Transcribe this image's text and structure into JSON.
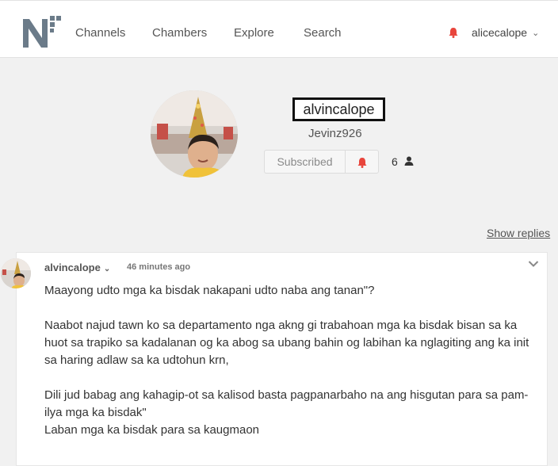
{
  "nav": {
    "items": [
      "Channels",
      "Chambers",
      "Explore",
      "Search"
    ],
    "user": "alicecalope"
  },
  "profile": {
    "username": "alvincalope",
    "handle": "Jevinz926",
    "subscribe_label": "Subscribed",
    "subscriber_count": "6"
  },
  "show_replies": "Show replies",
  "comment": {
    "author": "alvincalope",
    "time": "46 minutes ago",
    "lines": [
      "Maayong udto mga ka bisdak nakapani udto naba ang tanan\"?",
      "Naabot najud tawn ko sa departamento nga akng gi trabahoan mga ka bisdak bisan sa ka",
      "huot sa trapiko sa kadalanan og ka abog sa ubang bahin og labihan ka nglagiting ang ka init",
      "sa haring adlaw sa ka udtohun krn,",
      "Dili jud babag ang kahagip-ot sa kalisod basta pagpanarbaho na ang hisgutan para sa pam-",
      "ilya mga ka bisdak\"",
      "Laban mga ka bisdak para sa kaugmaon"
    ]
  },
  "colors": {
    "accent_red": "#e8453c",
    "logo_gray": "#6b7b89"
  }
}
